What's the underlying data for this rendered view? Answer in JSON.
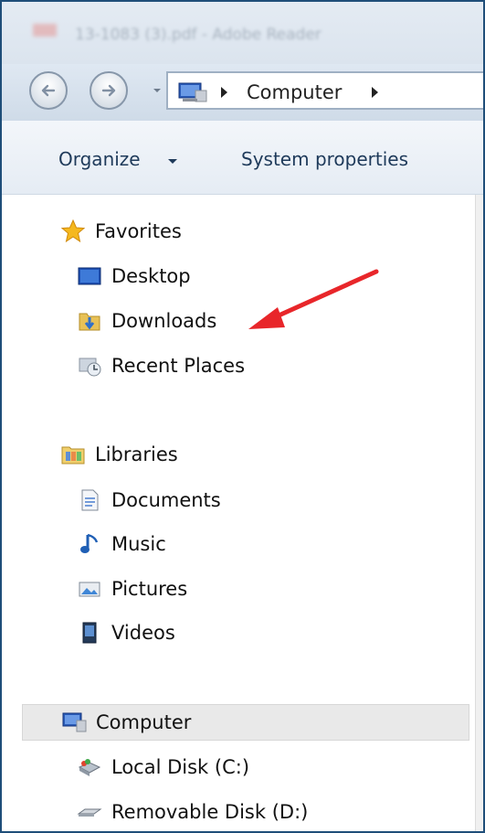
{
  "window": {
    "title": "13-1083 (3).pdf - Adobe Reader"
  },
  "address_bar": {
    "path": [
      "Computer"
    ]
  },
  "toolbar": {
    "organize_label": "Organize",
    "system_properties_label": "System properties"
  },
  "nav_pane": {
    "favorites": {
      "label": "Favorites",
      "items": [
        "Desktop",
        "Downloads",
        "Recent Places"
      ]
    },
    "libraries": {
      "label": "Libraries",
      "items": [
        "Documents",
        "Music",
        "Pictures",
        "Videos"
      ]
    },
    "computer": {
      "label": "Computer",
      "items": [
        "Local Disk (C:)",
        "Removable Disk (D:)"
      ]
    }
  },
  "annotation": {
    "arrow_color": "#e8262a",
    "target": "Downloads"
  },
  "colors": {
    "selection": "#e9e9e9",
    "frame": "#1f4e79",
    "toolbar_text": "#1e3a5a"
  }
}
